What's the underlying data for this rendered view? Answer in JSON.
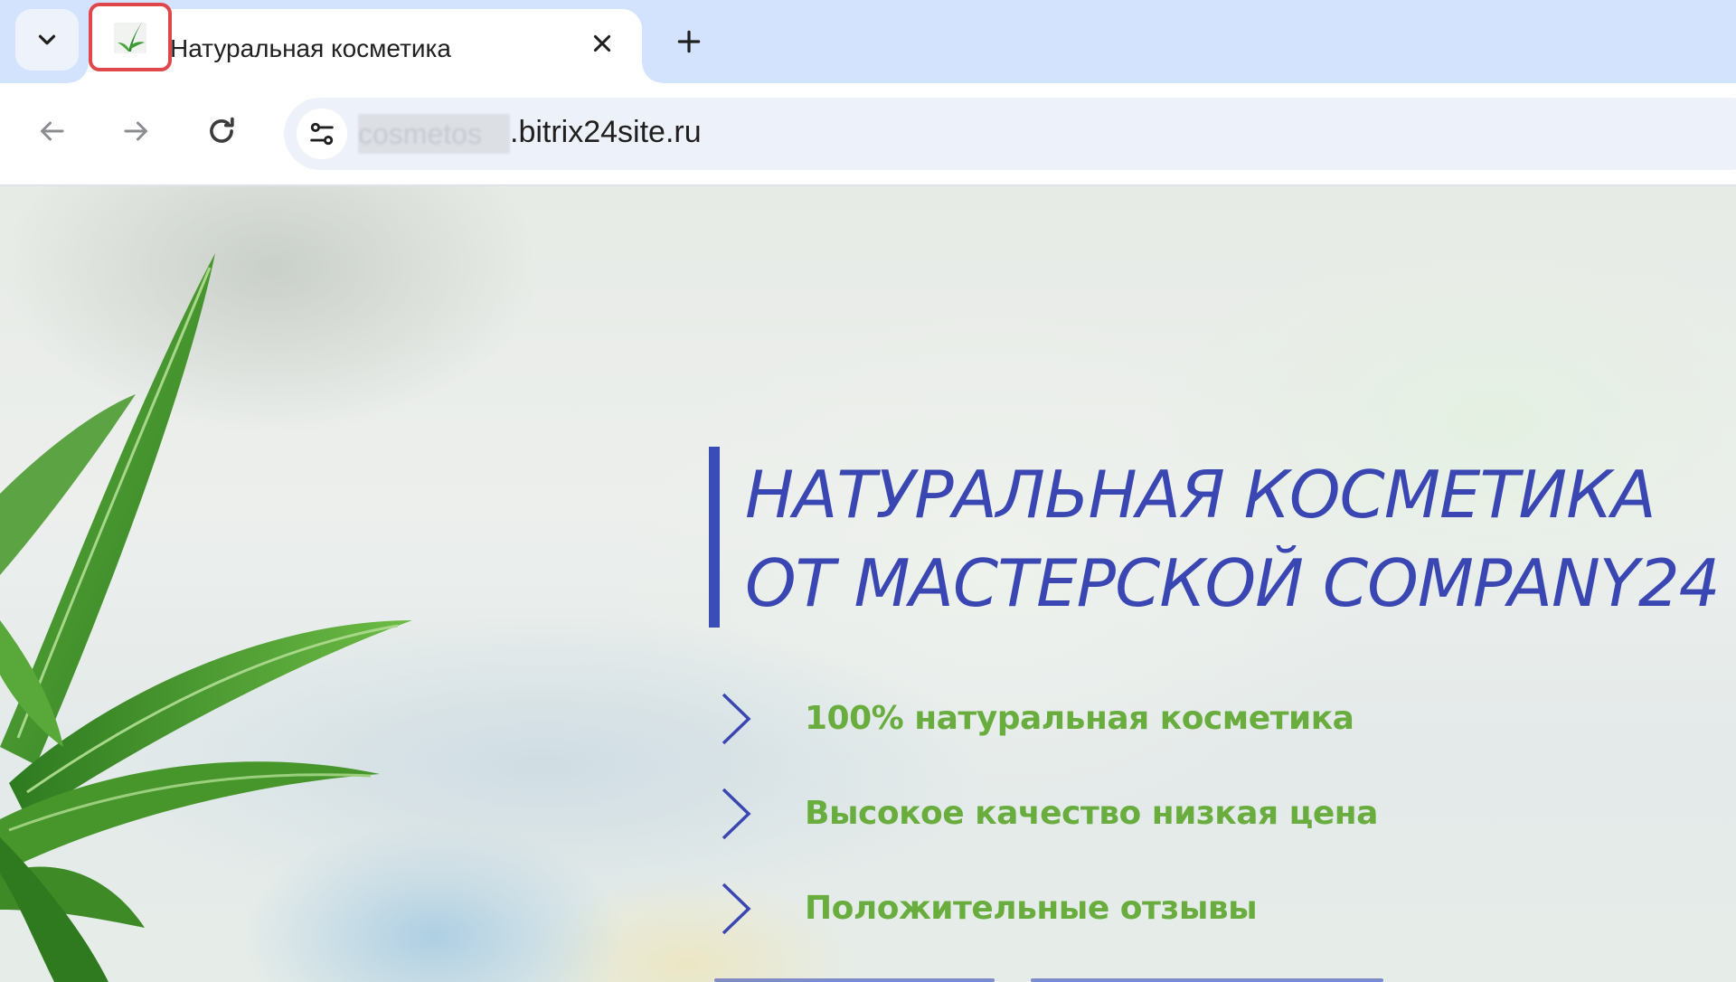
{
  "tab": {
    "title": "Натуральная косметика",
    "favicon": "leaf-icon",
    "close_icon": "close-icon"
  },
  "tabstrip": {
    "search_icon": "chevron-down-icon",
    "new_tab_icon": "plus-icon"
  },
  "toolbar": {
    "back_icon": "arrow-left-icon",
    "forward_icon": "arrow-right-icon",
    "reload_icon": "reload-icon",
    "site_info_icon": "tune-icon",
    "url_hidden_part": "cosmetos",
    "url_visible_part": ".bitrix24site.ru"
  },
  "hero": {
    "title": "Натуральная косметика от мастерской Company24",
    "features": [
      {
        "text": "100% натуральная косметика"
      },
      {
        "text": "Высокое качество низкая цена"
      },
      {
        "text": "Положительные отзывы"
      }
    ]
  },
  "colors": {
    "tabstrip_bg": "#d3e3fd",
    "omnibox_bg": "#edf2fa",
    "highlight_border": "#e0474c",
    "title_blue": "#3a46b2",
    "accent_bar": "#3a4db7",
    "feature_green": "#69ad3f"
  }
}
